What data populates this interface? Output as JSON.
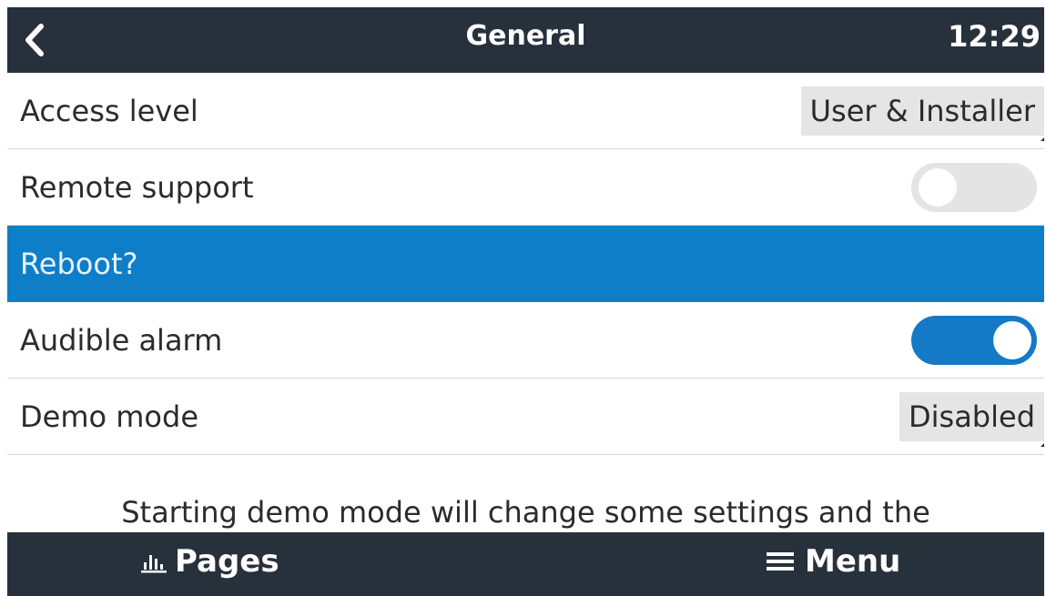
{
  "header": {
    "title": "General",
    "time": "12:29"
  },
  "settings": [
    {
      "label": "Access level",
      "value": "User & Installer",
      "kind": "value"
    },
    {
      "label": "Remote support",
      "state": "off",
      "kind": "toggle"
    },
    {
      "label": "Reboot?",
      "kind": "selected"
    },
    {
      "label": "Audible alarm",
      "state": "on",
      "kind": "toggle"
    },
    {
      "label": "Demo mode",
      "value": "Disabled",
      "kind": "value"
    }
  ],
  "info_text": "Starting demo mode will change some settings and the",
  "footer": {
    "pages_label": "Pages",
    "pages_icon": "bar-chart-icon",
    "menu_label": "Menu",
    "menu_icon": "hamburger-menu-icon"
  },
  "colors": {
    "header_bg": "#27313b",
    "selection": "#0f7ec9",
    "toggle_on": "#1479c7",
    "toggle_off": "#e4e4e4",
    "value_box": "#e5e5e5"
  }
}
